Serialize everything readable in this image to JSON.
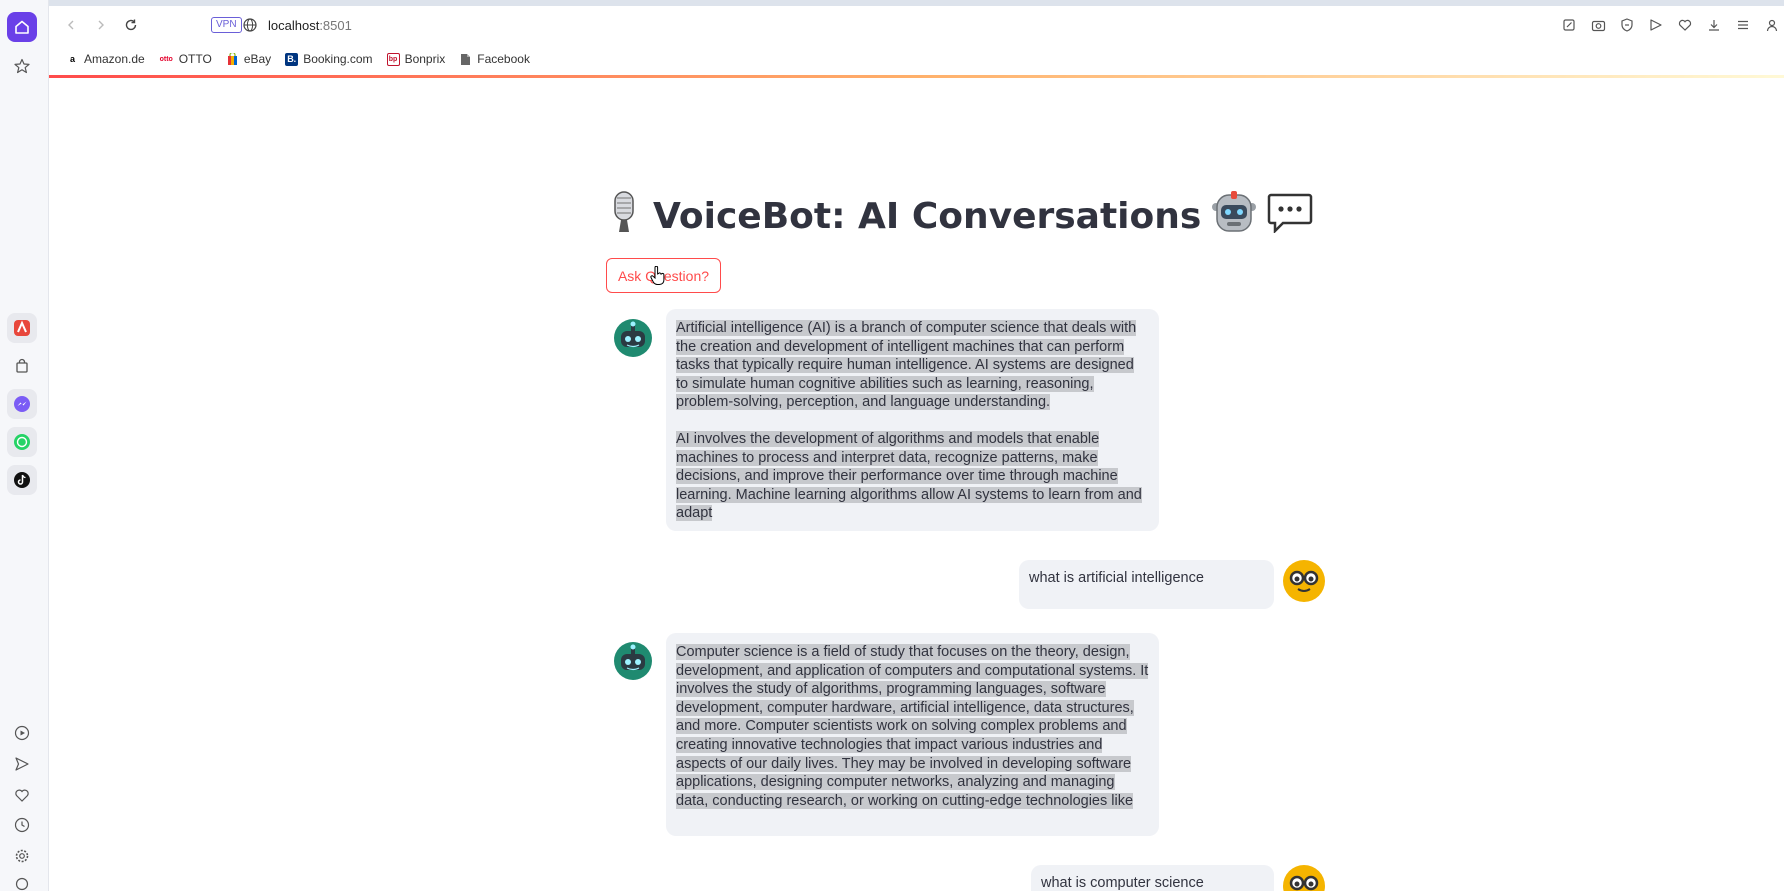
{
  "browser": {
    "vpn_label": "VPN",
    "url_host": "localhost",
    "url_port": ":8501"
  },
  "bookmarks": [
    {
      "label": "Amazon.de",
      "icon": "amazon-icon",
      "color": "#000000"
    },
    {
      "label": "OTTO",
      "icon": "otto-icon",
      "color": "#e4002b"
    },
    {
      "label": "eBay",
      "icon": "ebay-icon",
      "color": "#e53238"
    },
    {
      "label": "Booking.com",
      "icon": "booking-icon",
      "color": "#003580"
    },
    {
      "label": "Bonprix",
      "icon": "bonprix-icon",
      "color": "#c0142e"
    },
    {
      "label": "Facebook",
      "icon": "facebook-page-icon",
      "color": "#555555"
    }
  ],
  "page": {
    "title": "VoiceBot: AI Conversations",
    "title_emojis": {
      "left": "🎙️",
      "right": "🤖 💬"
    },
    "ask_button_label": "Ask Question?"
  },
  "messages": [
    {
      "role": "assistant",
      "paragraphs": [
        "Artificial intelligence (AI) is a branch of computer science that deals with the creation and development of intelligent machines that can perform tasks that typically require human intelligence. AI systems are designed to simulate human cognitive abilities such as learning, reasoning, problem-solving, perception, and language understanding.",
        "AI involves the development of algorithms and models that enable machines to process and interpret data, recognize patterns, make decisions, and improve their performance over time through machine learning. Machine learning algorithms allow AI systems to learn from and adapt"
      ]
    },
    {
      "role": "user",
      "text": "what is artificial intelligence"
    },
    {
      "role": "assistant",
      "paragraphs": [
        "Computer science is a field of study that focuses on the theory, design, development, and application of computers and computational systems. It involves the study of algorithms, programming languages, software development, computer hardware, artificial intelligence, data structures, and more. Computer scientists work on solving complex problems and creating innovative technologies that impact various industries and aspects of our daily lives. They may be involved in developing software applications, designing computer networks, analyzing and managing data, conducting research, or working on cutting-edge technologies like"
      ]
    },
    {
      "role": "user",
      "text": "what is computer science"
    }
  ],
  "colors": {
    "accent": "#ff4b4b",
    "opera_purple": "#6a40e8",
    "bubble_bg": "#f0f2f6",
    "bot_avatar": "#1f8a70",
    "user_avatar": "#f5b400"
  }
}
